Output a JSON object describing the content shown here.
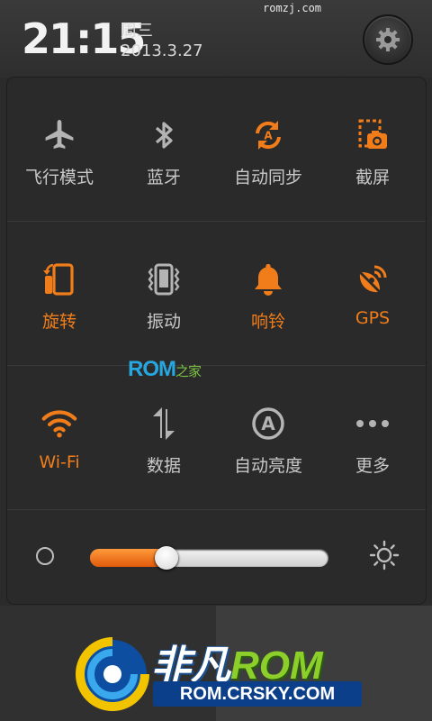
{
  "status": {
    "time": "21:15",
    "weekday": "周三",
    "date": "2013.3.27",
    "watermark": "romzj.com"
  },
  "header": {
    "settings_icon": "gear-icon"
  },
  "toggles": [
    {
      "label": "飞行模式",
      "icon": "airplane-icon",
      "on": false
    },
    {
      "label": "蓝牙",
      "icon": "bluetooth-icon",
      "on": false
    },
    {
      "label": "自动同步",
      "icon": "sync-icon",
      "on": true
    },
    {
      "label": "截屏",
      "icon": "screenshot-icon",
      "on": true
    },
    {
      "label": "旋转",
      "icon": "rotate-icon",
      "on": true
    },
    {
      "label": "振动",
      "icon": "vibrate-icon",
      "on": false
    },
    {
      "label": "响铃",
      "icon": "bell-icon",
      "on": true
    },
    {
      "label": "GPS",
      "icon": "gps-icon",
      "on": true
    },
    {
      "label": "Wi-Fi",
      "icon": "wifi-icon",
      "on": true
    },
    {
      "label": "数据",
      "icon": "data-icon",
      "on": false
    },
    {
      "label": "自动亮度",
      "icon": "auto-brightness-icon",
      "on": false
    },
    {
      "label": "更多",
      "icon": "more-icon",
      "on": false
    }
  ],
  "overlay_logo": {
    "text": "ROM",
    "suffix": "之家"
  },
  "brightness": {
    "level": 0.32
  },
  "brand": {
    "name_a": "非凡",
    "name_b": "ROM",
    "url": "ROM.CRSKY.COM"
  },
  "colors": {
    "accent": "#f07d1a",
    "inactive": "#b4b4b4"
  }
}
